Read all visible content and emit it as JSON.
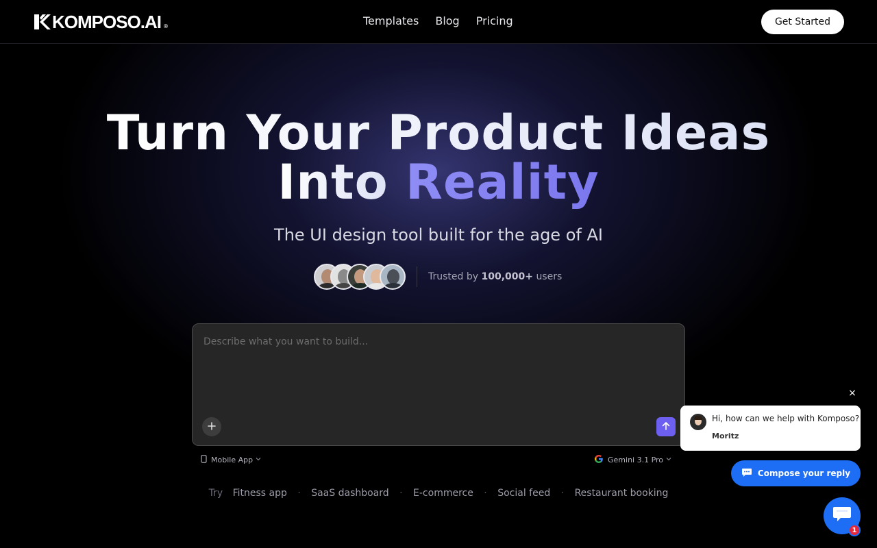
{
  "header": {
    "logo_text": "KOMPOSO.AI",
    "logo_mark": "®",
    "nav": [
      {
        "label": "Templates"
      },
      {
        "label": "Blog"
      },
      {
        "label": "Pricing"
      }
    ],
    "cta_label": "Get Started"
  },
  "hero": {
    "title_line1": "Turn Your Product Ideas",
    "title_line2_plain": "Into",
    "title_line2_highlight": "Reality",
    "subtitle": "The UI design tool built for the age of AI",
    "trust_prefix": "Trusted by",
    "trust_count": "100,000+",
    "trust_suffix": "users"
  },
  "prompt": {
    "placeholder": "Describe what you want to build...",
    "value": "",
    "platform_label": "Mobile App",
    "model_label": "Gemini 3.1 Pro"
  },
  "suggestions": {
    "prefix": "Try",
    "items": [
      "Fitness app",
      "SaaS dashboard",
      "E-commerce",
      "Social feed",
      "Restaurant booking"
    ]
  },
  "chat": {
    "close_glyph": "×",
    "message": "Hi, how can we help with Komposo?",
    "agent_name": "Moritz",
    "compose_label": "Compose your reply",
    "unread_count": "1"
  },
  "colors": {
    "accent": "#6d5ff0",
    "highlight": "#8f8df5",
    "chat_blue": "#1d6ef5",
    "badge_red": "#e5283a"
  },
  "icons": [
    "logo-k-icon",
    "plus-icon",
    "arrow-up-icon",
    "phone-icon",
    "chevron-down-icon",
    "google-g-icon",
    "close-icon",
    "chat-bubble-icon"
  ]
}
